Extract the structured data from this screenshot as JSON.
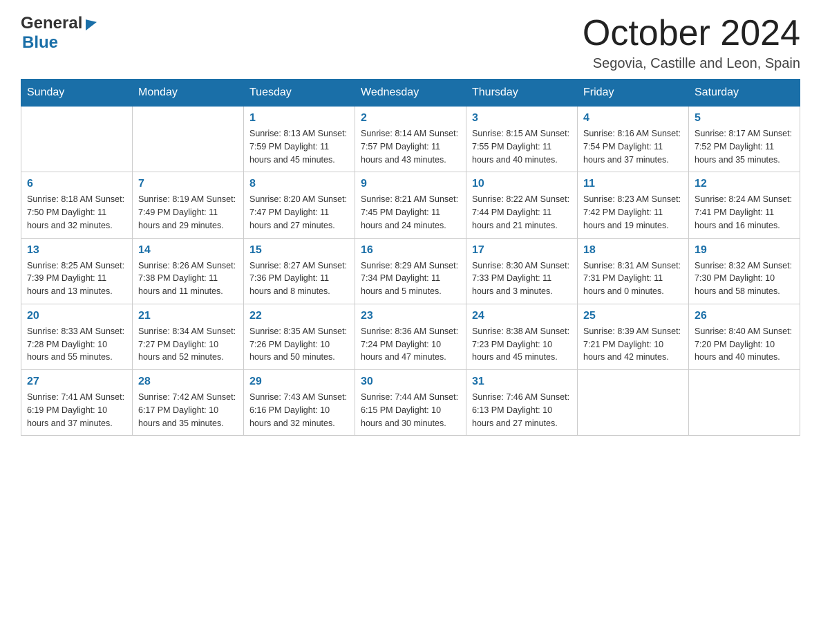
{
  "header": {
    "logo_general": "General",
    "logo_blue": "Blue",
    "month_title": "October 2024",
    "location": "Segovia, Castille and Leon, Spain"
  },
  "days_of_week": [
    "Sunday",
    "Monday",
    "Tuesday",
    "Wednesday",
    "Thursday",
    "Friday",
    "Saturday"
  ],
  "weeks": [
    [
      {
        "day": "",
        "info": ""
      },
      {
        "day": "",
        "info": ""
      },
      {
        "day": "1",
        "info": "Sunrise: 8:13 AM\nSunset: 7:59 PM\nDaylight: 11 hours\nand 45 minutes."
      },
      {
        "day": "2",
        "info": "Sunrise: 8:14 AM\nSunset: 7:57 PM\nDaylight: 11 hours\nand 43 minutes."
      },
      {
        "day": "3",
        "info": "Sunrise: 8:15 AM\nSunset: 7:55 PM\nDaylight: 11 hours\nand 40 minutes."
      },
      {
        "day": "4",
        "info": "Sunrise: 8:16 AM\nSunset: 7:54 PM\nDaylight: 11 hours\nand 37 minutes."
      },
      {
        "day": "5",
        "info": "Sunrise: 8:17 AM\nSunset: 7:52 PM\nDaylight: 11 hours\nand 35 minutes."
      }
    ],
    [
      {
        "day": "6",
        "info": "Sunrise: 8:18 AM\nSunset: 7:50 PM\nDaylight: 11 hours\nand 32 minutes."
      },
      {
        "day": "7",
        "info": "Sunrise: 8:19 AM\nSunset: 7:49 PM\nDaylight: 11 hours\nand 29 minutes."
      },
      {
        "day": "8",
        "info": "Sunrise: 8:20 AM\nSunset: 7:47 PM\nDaylight: 11 hours\nand 27 minutes."
      },
      {
        "day": "9",
        "info": "Sunrise: 8:21 AM\nSunset: 7:45 PM\nDaylight: 11 hours\nand 24 minutes."
      },
      {
        "day": "10",
        "info": "Sunrise: 8:22 AM\nSunset: 7:44 PM\nDaylight: 11 hours\nand 21 minutes."
      },
      {
        "day": "11",
        "info": "Sunrise: 8:23 AM\nSunset: 7:42 PM\nDaylight: 11 hours\nand 19 minutes."
      },
      {
        "day": "12",
        "info": "Sunrise: 8:24 AM\nSunset: 7:41 PM\nDaylight: 11 hours\nand 16 minutes."
      }
    ],
    [
      {
        "day": "13",
        "info": "Sunrise: 8:25 AM\nSunset: 7:39 PM\nDaylight: 11 hours\nand 13 minutes."
      },
      {
        "day": "14",
        "info": "Sunrise: 8:26 AM\nSunset: 7:38 PM\nDaylight: 11 hours\nand 11 minutes."
      },
      {
        "day": "15",
        "info": "Sunrise: 8:27 AM\nSunset: 7:36 PM\nDaylight: 11 hours\nand 8 minutes."
      },
      {
        "day": "16",
        "info": "Sunrise: 8:29 AM\nSunset: 7:34 PM\nDaylight: 11 hours\nand 5 minutes."
      },
      {
        "day": "17",
        "info": "Sunrise: 8:30 AM\nSunset: 7:33 PM\nDaylight: 11 hours\nand 3 minutes."
      },
      {
        "day": "18",
        "info": "Sunrise: 8:31 AM\nSunset: 7:31 PM\nDaylight: 11 hours\nand 0 minutes."
      },
      {
        "day": "19",
        "info": "Sunrise: 8:32 AM\nSunset: 7:30 PM\nDaylight: 10 hours\nand 58 minutes."
      }
    ],
    [
      {
        "day": "20",
        "info": "Sunrise: 8:33 AM\nSunset: 7:28 PM\nDaylight: 10 hours\nand 55 minutes."
      },
      {
        "day": "21",
        "info": "Sunrise: 8:34 AM\nSunset: 7:27 PM\nDaylight: 10 hours\nand 52 minutes."
      },
      {
        "day": "22",
        "info": "Sunrise: 8:35 AM\nSunset: 7:26 PM\nDaylight: 10 hours\nand 50 minutes."
      },
      {
        "day": "23",
        "info": "Sunrise: 8:36 AM\nSunset: 7:24 PM\nDaylight: 10 hours\nand 47 minutes."
      },
      {
        "day": "24",
        "info": "Sunrise: 8:38 AM\nSunset: 7:23 PM\nDaylight: 10 hours\nand 45 minutes."
      },
      {
        "day": "25",
        "info": "Sunrise: 8:39 AM\nSunset: 7:21 PM\nDaylight: 10 hours\nand 42 minutes."
      },
      {
        "day": "26",
        "info": "Sunrise: 8:40 AM\nSunset: 7:20 PM\nDaylight: 10 hours\nand 40 minutes."
      }
    ],
    [
      {
        "day": "27",
        "info": "Sunrise: 7:41 AM\nSunset: 6:19 PM\nDaylight: 10 hours\nand 37 minutes."
      },
      {
        "day": "28",
        "info": "Sunrise: 7:42 AM\nSunset: 6:17 PM\nDaylight: 10 hours\nand 35 minutes."
      },
      {
        "day": "29",
        "info": "Sunrise: 7:43 AM\nSunset: 6:16 PM\nDaylight: 10 hours\nand 32 minutes."
      },
      {
        "day": "30",
        "info": "Sunrise: 7:44 AM\nSunset: 6:15 PM\nDaylight: 10 hours\nand 30 minutes."
      },
      {
        "day": "31",
        "info": "Sunrise: 7:46 AM\nSunset: 6:13 PM\nDaylight: 10 hours\nand 27 minutes."
      },
      {
        "day": "",
        "info": ""
      },
      {
        "day": "",
        "info": ""
      }
    ]
  ]
}
